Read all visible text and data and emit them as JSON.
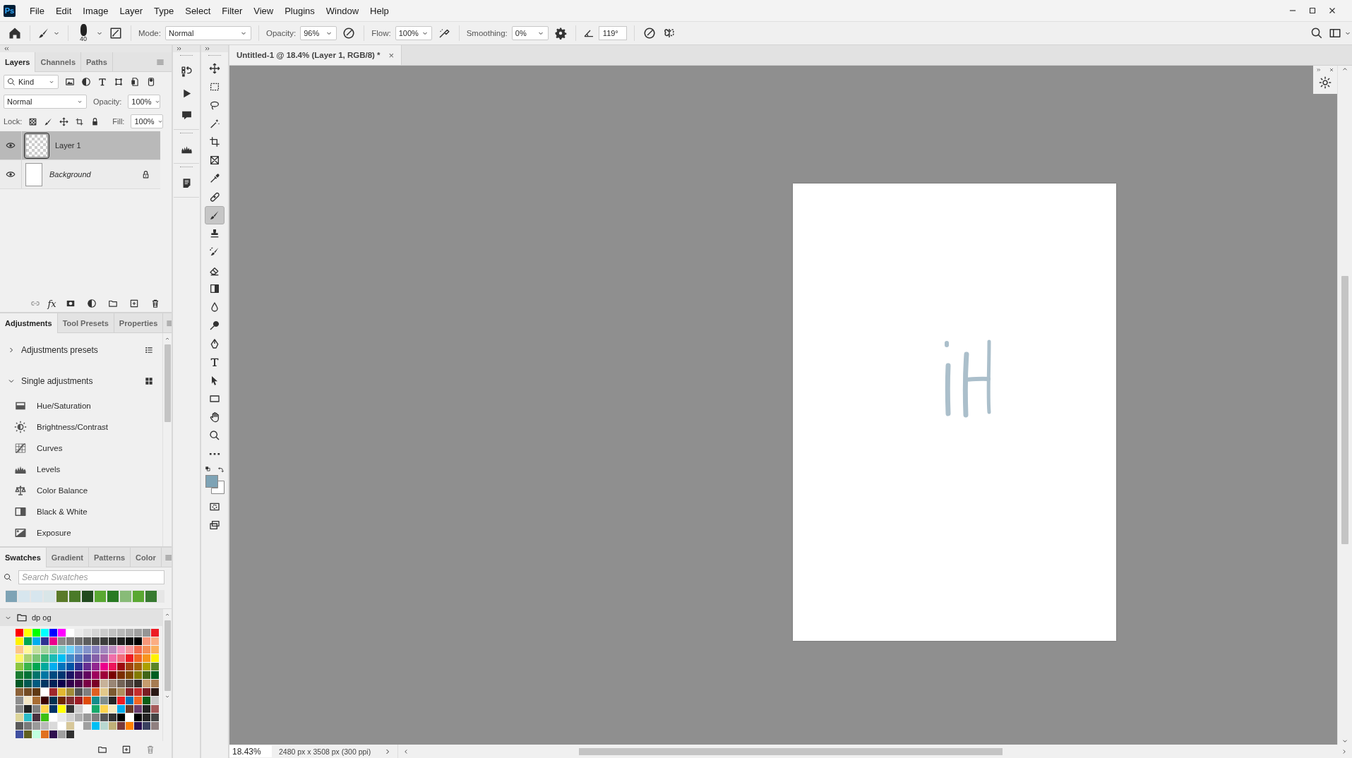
{
  "app_logo": "Ps",
  "menu": [
    "File",
    "Edit",
    "Image",
    "Layer",
    "Type",
    "Select",
    "Filter",
    "View",
    "Plugins",
    "Window",
    "Help"
  ],
  "options_bar": {
    "brush_size": "40",
    "mode_label": "Mode:",
    "mode": "Normal",
    "opacity_label": "Opacity:",
    "opacity": "96%",
    "flow_label": "Flow:",
    "flow": "100%",
    "smoothing_label": "Smoothing:",
    "smoothing": "0%",
    "angle": "119°"
  },
  "layers_panel": {
    "tabs": [
      {
        "label": "Layers",
        "selected": true
      },
      {
        "label": "Channels",
        "selected": false
      },
      {
        "label": "Paths",
        "selected": false
      }
    ],
    "filter": "Kind",
    "blend_mode": "Normal",
    "opacity_label": "Opacity:",
    "opacity": "100%",
    "lock_label": "Lock:",
    "fill_label": "Fill:",
    "fill": "100%",
    "fx_label": "fx",
    "layers": [
      {
        "name": "Layer 1",
        "kind": "transparent",
        "visible": true,
        "locked": false,
        "selected": true
      },
      {
        "name": "Background",
        "kind": "background",
        "visible": true,
        "locked": true,
        "selected": false
      }
    ]
  },
  "adjustments_panel": {
    "tabs": [
      {
        "label": "Adjustments",
        "selected": true
      },
      {
        "label": "Tool Presets",
        "selected": false
      },
      {
        "label": "Properties",
        "selected": false
      }
    ],
    "sections": [
      {
        "label": "Adjustments presets",
        "expanded": false,
        "kind": "list"
      },
      {
        "label": "Single adjustments",
        "expanded": true,
        "kind": "grid"
      }
    ],
    "items": [
      {
        "label": "Hue/Saturation",
        "kind": "hue"
      },
      {
        "label": "Brightness/Contrast",
        "kind": "brightness"
      },
      {
        "label": "Curves",
        "kind": "curves"
      },
      {
        "label": "Levels",
        "kind": "levels"
      },
      {
        "label": "Color Balance",
        "kind": "balance"
      },
      {
        "label": "Black & White",
        "kind": "bw"
      },
      {
        "label": "Exposure",
        "kind": "exposure"
      }
    ]
  },
  "swatches_panel": {
    "tabs": [
      {
        "label": "Swatches",
        "selected": true
      },
      {
        "label": "Gradient",
        "selected": false
      },
      {
        "label": "Patterns",
        "selected": false
      },
      {
        "label": "Color",
        "selected": false
      }
    ],
    "search_placeholder": "Search Swatches",
    "recent": [
      {
        "color": "#7ea3b5"
      },
      {
        "color": "#d7e6ee"
      },
      {
        "color": "#d7e6ee"
      },
      {
        "color": "#d9e6e8"
      },
      {
        "color": "#5a7a28"
      },
      {
        "color": "#4a7a28"
      },
      {
        "color": "#214a1e"
      },
      {
        "color": "#5aa832"
      },
      {
        "color": "#287a22"
      },
      {
        "color": "#88bb78"
      },
      {
        "color": "#5aa832"
      },
      {
        "color": "#377a30"
      }
    ],
    "group": {
      "name": "dp og",
      "expanded": true,
      "rows": [
        {
          "swatches": [
            {
              "color": "#ff0000"
            },
            {
              "color": "#ffff00"
            },
            {
              "color": "#00ff00"
            },
            {
              "color": "#00ffff"
            },
            {
              "color": "#0000ff"
            },
            {
              "color": "#ff00ff"
            },
            {
              "color": "#ffffff"
            },
            {
              "color": "#ebebeb"
            },
            {
              "color": "#e0e0e0"
            },
            {
              "color": "#d6d6d6"
            },
            {
              "color": "#cccccc"
            },
            {
              "color": "#c2c2c2"
            },
            {
              "color": "#b8b8b8"
            },
            {
              "color": "#adadad"
            },
            {
              "color": "#a0a0a0"
            },
            {
              "color": "#959595"
            },
            {
              "color": "#ed1c24"
            }
          ]
        },
        {
          "swatches": [
            {
              "color": "#fff200"
            },
            {
              "color": "#00a651"
            },
            {
              "color": "#00aeef"
            },
            {
              "color": "#2e3192"
            },
            {
              "color": "#ec008c"
            },
            {
              "color": "#898989"
            },
            {
              "color": "#7d7d7d"
            },
            {
              "color": "#6e6e6e"
            },
            {
              "color": "#5e5e5e"
            },
            {
              "color": "#4d4d4d"
            },
            {
              "color": "#3d3d3d"
            },
            {
              "color": "#2e2e2e"
            },
            {
              "color": "#1f1f1f"
            },
            {
              "color": "#0d0d0d"
            },
            {
              "color": "#000000"
            },
            {
              "color": "#f7977a"
            },
            {
              "color": "#fbad82"
            }
          ]
        },
        {
          "swatches": [
            {
              "color": "#fdc68a"
            },
            {
              "color": "#fff799"
            },
            {
              "color": "#c4df9b"
            },
            {
              "color": "#a3d39c"
            },
            {
              "color": "#82ca9c"
            },
            {
              "color": "#7accc8"
            },
            {
              "color": "#6dcff6"
            },
            {
              "color": "#7da7d9"
            },
            {
              "color": "#8393ca"
            },
            {
              "color": "#8882be"
            },
            {
              "color": "#a187be"
            },
            {
              "color": "#bc8dbf"
            },
            {
              "color": "#f49ac2"
            },
            {
              "color": "#f6989d"
            },
            {
              "color": "#f26c4f"
            },
            {
              "color": "#f68e56"
            },
            {
              "color": "#fbaf5d"
            }
          ]
        },
        {
          "swatches": [
            {
              "color": "#fff568"
            },
            {
              "color": "#acd373"
            },
            {
              "color": "#7cc576"
            },
            {
              "color": "#3cb878"
            },
            {
              "color": "#1cbbb4"
            },
            {
              "color": "#00bff3"
            },
            {
              "color": "#438ccb"
            },
            {
              "color": "#5574b9"
            },
            {
              "color": "#605ca8"
            },
            {
              "color": "#855fa8"
            },
            {
              "color": "#a763a8"
            },
            {
              "color": "#f06ea9"
            },
            {
              "color": "#f26d7d"
            },
            {
              "color": "#ed1c24"
            },
            {
              "color": "#f26522"
            },
            {
              "color": "#f7941d"
            },
            {
              "color": "#fff200"
            }
          ]
        },
        {
          "swatches": [
            {
              "color": "#8dc63f"
            },
            {
              "color": "#39b54a"
            },
            {
              "color": "#00a651"
            },
            {
              "color": "#00a99d"
            },
            {
              "color": "#00aeef"
            },
            {
              "color": "#0072bc"
            },
            {
              "color": "#0054a6"
            },
            {
              "color": "#2e3192"
            },
            {
              "color": "#662d91"
            },
            {
              "color": "#92278f"
            },
            {
              "color": "#ec008c"
            },
            {
              "color": "#ed145b"
            },
            {
              "color": "#9e0b0f"
            },
            {
              "color": "#a0410d"
            },
            {
              "color": "#a36209"
            },
            {
              "color": "#aba000"
            },
            {
              "color": "#598527"
            }
          ]
        },
        {
          "swatches": [
            {
              "color": "#197b30"
            },
            {
              "color": "#007236"
            },
            {
              "color": "#00746b"
            },
            {
              "color": "#0076a3"
            },
            {
              "color": "#004a80"
            },
            {
              "color": "#003471"
            },
            {
              "color": "#1b1464"
            },
            {
              "color": "#440e62"
            },
            {
              "color": "#630460"
            },
            {
              "color": "#9e005d"
            },
            {
              "color": "#9e0039"
            },
            {
              "color": "#790000"
            },
            {
              "color": "#7b2e00"
            },
            {
              "color": "#7d4900"
            },
            {
              "color": "#827b00"
            },
            {
              "color": "#406618"
            },
            {
              "color": "#005e20"
            }
          ]
        },
        {
          "swatches": [
            {
              "color": "#005826"
            },
            {
              "color": "#005952"
            },
            {
              "color": "#005b7f"
            },
            {
              "color": "#003663"
            },
            {
              "color": "#002157"
            },
            {
              "color": "#0d004c"
            },
            {
              "color": "#32004b"
            },
            {
              "color": "#4b0049"
            },
            {
              "color": "#7b0046"
            },
            {
              "color": "#7a0026"
            },
            {
              "color": "#c7b299"
            },
            {
              "color": "#998675"
            },
            {
              "color": "#736357"
            },
            {
              "color": "#534741"
            },
            {
              "color": "#37302a"
            },
            {
              "color": "#c69c6d"
            },
            {
              "color": "#a67c52"
            }
          ]
        },
        {
          "swatches": [
            {
              "color": "#8c6239"
            },
            {
              "color": "#754c24"
            },
            {
              "color": "#603913"
            },
            {
              "color": "#ffffff"
            },
            {
              "color": "#a0282c"
            },
            {
              "color": "#e2b832"
            },
            {
              "color": "#a08c39"
            },
            {
              "color": "#545454"
            },
            {
              "color": "#7f7f7f"
            },
            {
              "color": "#e05f22"
            },
            {
              "color": "#e2c98a"
            },
            {
              "color": "#7d5a31"
            },
            {
              "color": "#b08e5e"
            },
            {
              "color": "#8b2227"
            },
            {
              "color": "#c62d2d"
            },
            {
              "color": "#7a1e23"
            },
            {
              "color": "#2a1814"
            }
          ]
        },
        {
          "swatches": [
            {
              "color": "#8e8e8e"
            },
            {
              "color": "#f3e6c6"
            },
            {
              "color": "#a86d33"
            },
            {
              "color": "#3b0000"
            },
            {
              "color": "#003150"
            },
            {
              "color": "#6e2800"
            },
            {
              "color": "#7e2d30"
            },
            {
              "color": "#9d1b24"
            },
            {
              "color": "#e04c0a"
            },
            {
              "color": "#138c8c"
            },
            {
              "color": "#7f8e8e"
            },
            {
              "color": "#262626"
            },
            {
              "color": "#ed1c24"
            },
            {
              "color": "#0073bc"
            },
            {
              "color": "#f26522"
            },
            {
              "color": "#0b5e16"
            },
            {
              "color": "#c8c8c8"
            }
          ]
        },
        {
          "swatches": [
            {
              "color": "#888888"
            },
            {
              "color": "#222222"
            },
            {
              "color": "#808080"
            },
            {
              "color": "#ffd54f"
            },
            {
              "color": "#003366"
            },
            {
              "color": "#ffff00"
            },
            {
              "color": "#333333"
            },
            {
              "color": "#cccccc"
            },
            {
              "color": "#f8f8f8"
            },
            {
              "color": "#16a96b"
            },
            {
              "color": "#ffd54f"
            },
            {
              "color": "#f5e9c0"
            },
            {
              "color": "#00aeef"
            },
            {
              "color": "#6a3a28"
            },
            {
              "color": "#6b3f6e"
            },
            {
              "color": "#222222"
            },
            {
              "color": "#a55a5a"
            }
          ]
        },
        {
          "swatches": [
            {
              "color": "#ddd59b"
            },
            {
              "color": "#2bbcc8"
            },
            {
              "color": "#48303e"
            },
            {
              "color": "#3cc012"
            },
            {
              "color": "#ffffff"
            },
            {
              "color": "#e8e8e8"
            },
            {
              "color": "#d0d0d0"
            },
            {
              "color": "#b0b0b0"
            },
            {
              "color": "#999999"
            },
            {
              "color": "#7f7f7f"
            },
            {
              "color": "#555555"
            },
            {
              "color": "#333333"
            },
            {
              "color": "#000000"
            },
            {
              "color": "#ffffff"
            },
            {
              "color": "#000000"
            },
            {
              "color": "#222222"
            },
            {
              "color": "#444444"
            }
          ]
        },
        {
          "swatches": [
            {
              "color": "#5a5a5a"
            },
            {
              "color": "#7a7a7a"
            },
            {
              "color": "#9a9a9a"
            },
            {
              "color": "#bababa"
            },
            {
              "color": "#dadada"
            },
            {
              "color": "#ffffff"
            },
            {
              "color": "#d8c89a"
            },
            {
              "color": "#f8f8f8"
            },
            {
              "color": "#a0a0a0"
            },
            {
              "color": "#00bff3"
            },
            {
              "color": "#b8d8d0"
            },
            {
              "color": "#c0b078"
            },
            {
              "color": "#7a3a3a"
            },
            {
              "color": "#ff8000"
            },
            {
              "color": "#2a1050"
            },
            {
              "color": "#3a4060"
            },
            {
              "color": "#908080"
            }
          ]
        },
        {
          "swatches": [
            {
              "color": "#4050a0"
            },
            {
              "color": "#606020"
            },
            {
              "color": "#c0ffe0"
            },
            {
              "color": "#e07020"
            },
            {
              "color": "#301050"
            },
            {
              "color": "#a0a0a0"
            },
            {
              "color": "#303030"
            }
          ]
        }
      ]
    }
  },
  "dock": [
    {
      "kind": "history"
    },
    {
      "kind": "play"
    },
    {
      "kind": "comment"
    },
    {
      "kind": "histogram"
    },
    {
      "kind": "notes"
    }
  ],
  "tools": [
    {
      "kind": "move",
      "selected": false
    },
    {
      "kind": "marquee",
      "selected": false
    },
    {
      "kind": "lasso",
      "selected": false
    },
    {
      "kind": "wand",
      "selected": false
    },
    {
      "kind": "crop",
      "selected": false
    },
    {
      "kind": "frame",
      "selected": false
    },
    {
      "kind": "eyedropper",
      "selected": false
    },
    {
      "kind": "bandage",
      "selected": false
    },
    {
      "kind": "brush",
      "selected": true
    },
    {
      "kind": "stamp",
      "selected": false
    },
    {
      "kind": "historybrush",
      "selected": false
    },
    {
      "kind": "eraser",
      "selected": false
    },
    {
      "kind": "gradient",
      "selected": false
    },
    {
      "kind": "drop",
      "selected": false
    },
    {
      "kind": "dodge",
      "selected": false
    },
    {
      "kind": "pen",
      "selected": false
    },
    {
      "kind": "type",
      "selected": false
    },
    {
      "kind": "pointer",
      "selected": false
    },
    {
      "kind": "rect",
      "selected": false
    },
    {
      "kind": "hand",
      "selected": false
    },
    {
      "kind": "zoom",
      "selected": false
    },
    {
      "kind": "more",
      "selected": false
    }
  ],
  "colors": [
    {
      "color": "#7ea3b5"
    },
    {
      "color": "#ffffff"
    }
  ],
  "document": {
    "tab_title": "Untitled-1 @ 18.4% (Layer 1, RGB/8) *",
    "close": "×",
    "zoom": "18.43%",
    "dimensions": "2480 px x 3508 px (300 ppi)"
  }
}
